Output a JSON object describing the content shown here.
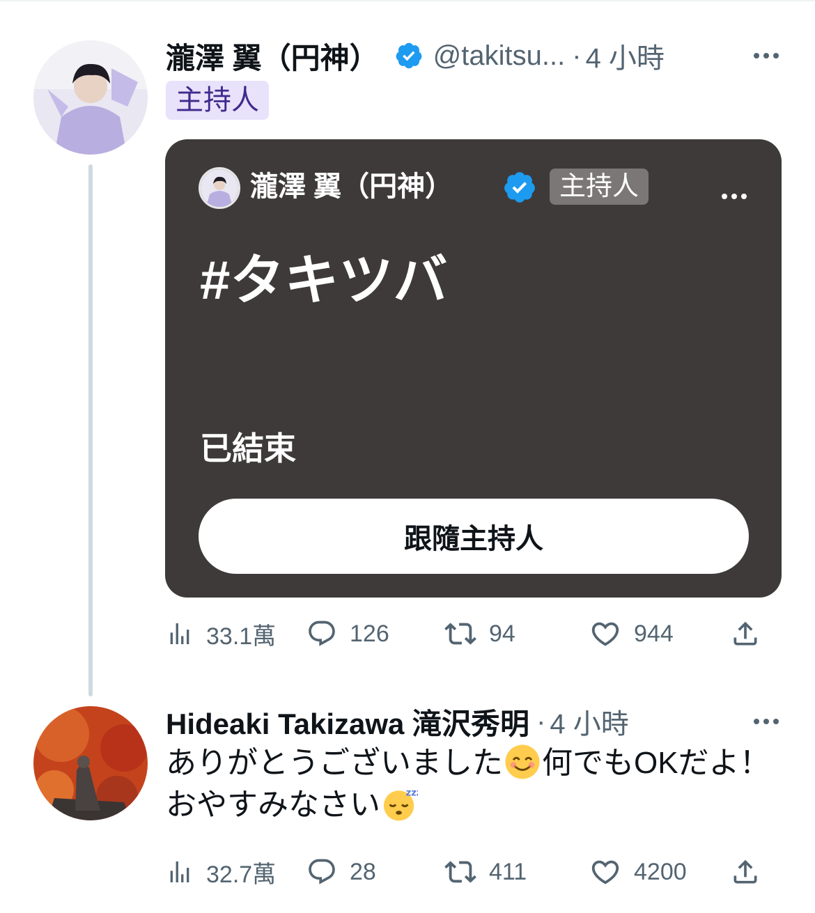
{
  "tweet1": {
    "author_name": "瀧澤 翼（円神）",
    "handle": "@takitsu...",
    "separator": "·",
    "time": "4 小時",
    "role_pill": "主持人",
    "space": {
      "host_name": "瀧澤 翼（円神）",
      "host_badge": "主持人",
      "title": "#タキツバ",
      "status": "已結束",
      "button_label": "跟隨主持人"
    },
    "stats": {
      "views": "33.1萬",
      "replies": "126",
      "retweets": "94",
      "likes": "944"
    }
  },
  "tweet2": {
    "author_name": "Hideaki Takizawa 滝沢秀明",
    "separator": "·",
    "time": "4 小時",
    "text_part1": "ありがとうございました",
    "text_part2": "何でもOKだよ！おやすみなさい",
    "emoji1": "smiling-face-emoji",
    "emoji2": "sleeping-face-emoji",
    "stats": {
      "views": "32.7萬",
      "replies": "28",
      "retweets": "411",
      "likes": "4200"
    }
  },
  "colors": {
    "space_card_bg": "#3e3a3a",
    "verified_blue": "#1d9bf0",
    "secondary_text": "#536471",
    "host_pill_bg": "#e8e2fb",
    "host_pill_text": "#3f2a8c"
  }
}
